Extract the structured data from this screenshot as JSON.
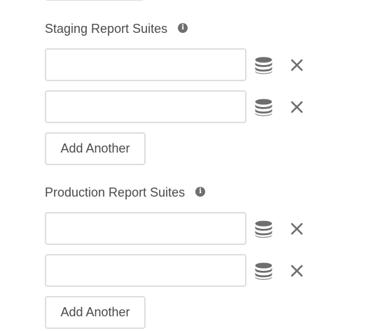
{
  "staging": {
    "label": "Staging Report Suites",
    "info_icon": "info-icon",
    "fields": [
      {
        "value": "",
        "placeholder": ""
      },
      {
        "value": "",
        "placeholder": ""
      }
    ],
    "add_label": "Add Another"
  },
  "production": {
    "label": "Production Report Suites",
    "info_icon": "info-icon",
    "fields": [
      {
        "value": "",
        "placeholder": ""
      },
      {
        "value": "",
        "placeholder": ""
      }
    ],
    "add_label": "Add Another"
  },
  "icons": {
    "data_element": "database-icon",
    "remove": "close-icon"
  },
  "colors": {
    "text": "#4b4b4b",
    "border": "#dedede",
    "icon": "#6e6e6e"
  }
}
